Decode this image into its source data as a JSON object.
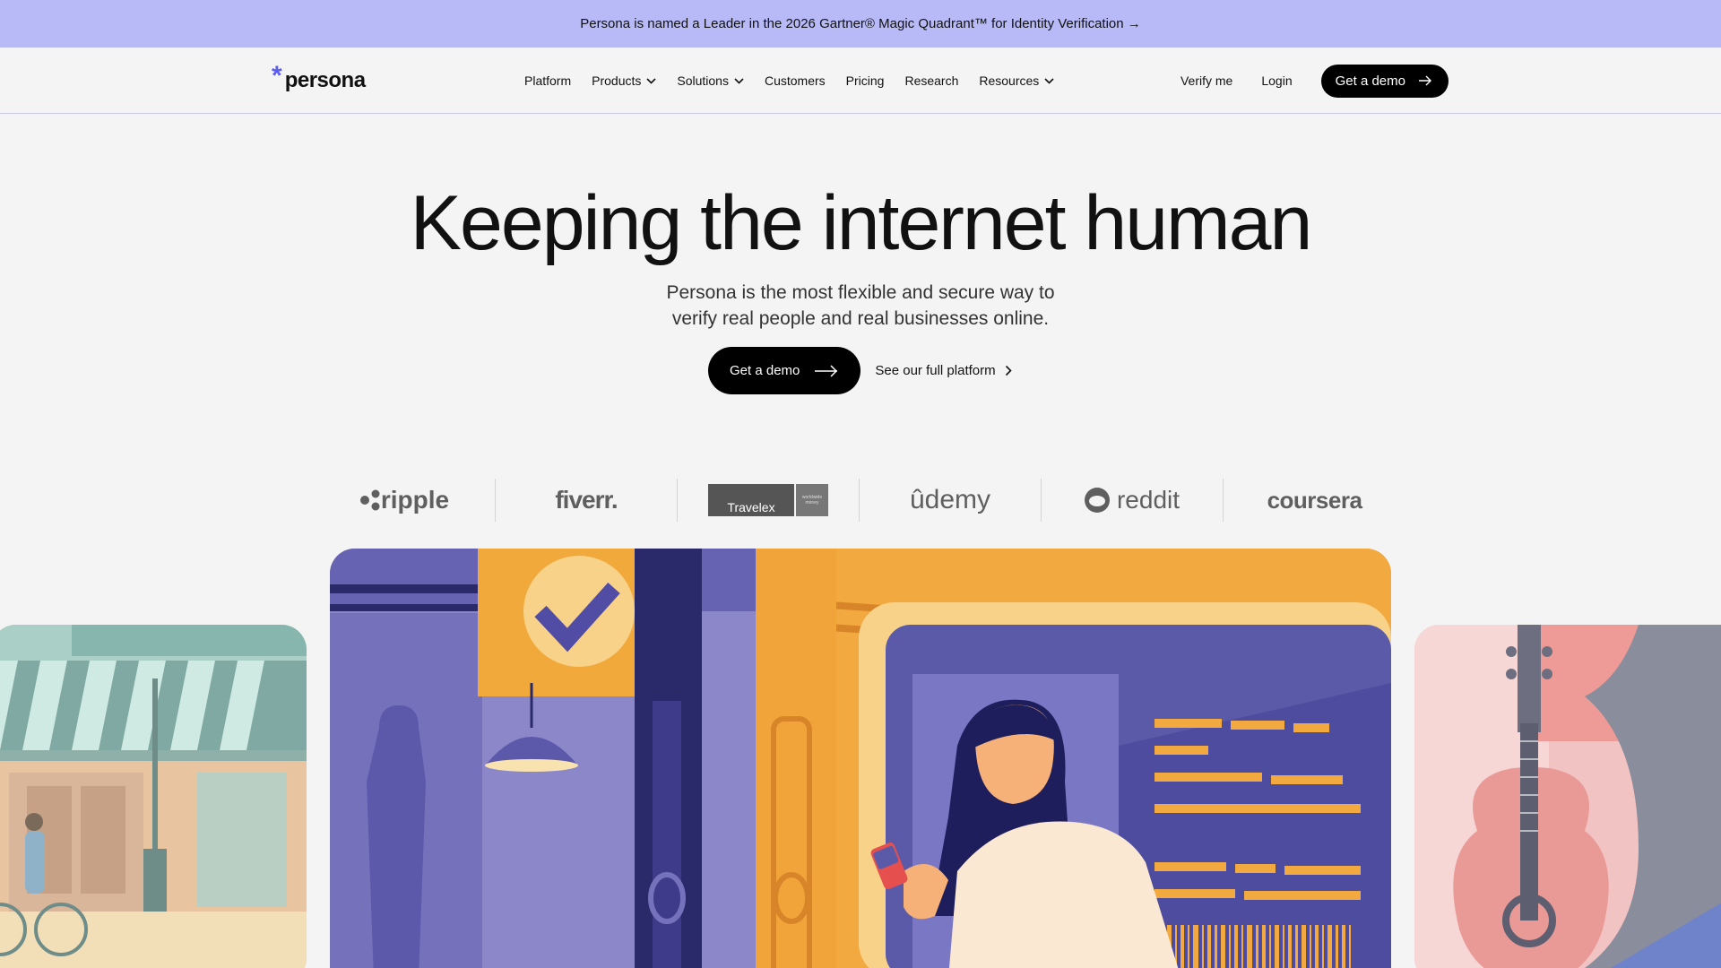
{
  "banner": {
    "text": "Persona is named a Leader in the 2026 Gartner® Magic Quadrant™ for Identity Verification →"
  },
  "header": {
    "logo_text": "persona",
    "nav": [
      {
        "label": "Platform",
        "dropdown": false
      },
      {
        "label": "Products",
        "dropdown": true
      },
      {
        "label": "Solutions",
        "dropdown": true
      },
      {
        "label": "Customers",
        "dropdown": false
      },
      {
        "label": "Pricing",
        "dropdown": false
      },
      {
        "label": "Research",
        "dropdown": false
      },
      {
        "label": "Resources",
        "dropdown": true
      }
    ],
    "verify_label": "Verify me",
    "login_label": "Login",
    "demo_label": "Get a demo"
  },
  "hero": {
    "title": "Keeping the internet human",
    "subtitle_line1": "Persona is the most flexible and secure way to",
    "subtitle_line2": "verify real people and real businesses online.",
    "demo_label": "Get a demo",
    "platform_label": "See our full platform"
  },
  "customer_logos": {
    "ripple": "ripple",
    "fiverr": "fiverr.",
    "travelex": "Travelex",
    "travelex_tag": "worldwide money",
    "udemy": "ûdemy",
    "reddit": "reddit",
    "coursera": "coursera"
  },
  "colors": {
    "banner_bg": "#b7baf7",
    "brand_accent": "#5b5bf0",
    "page_bg": "#f4f4f4",
    "button_bg": "#000000"
  }
}
